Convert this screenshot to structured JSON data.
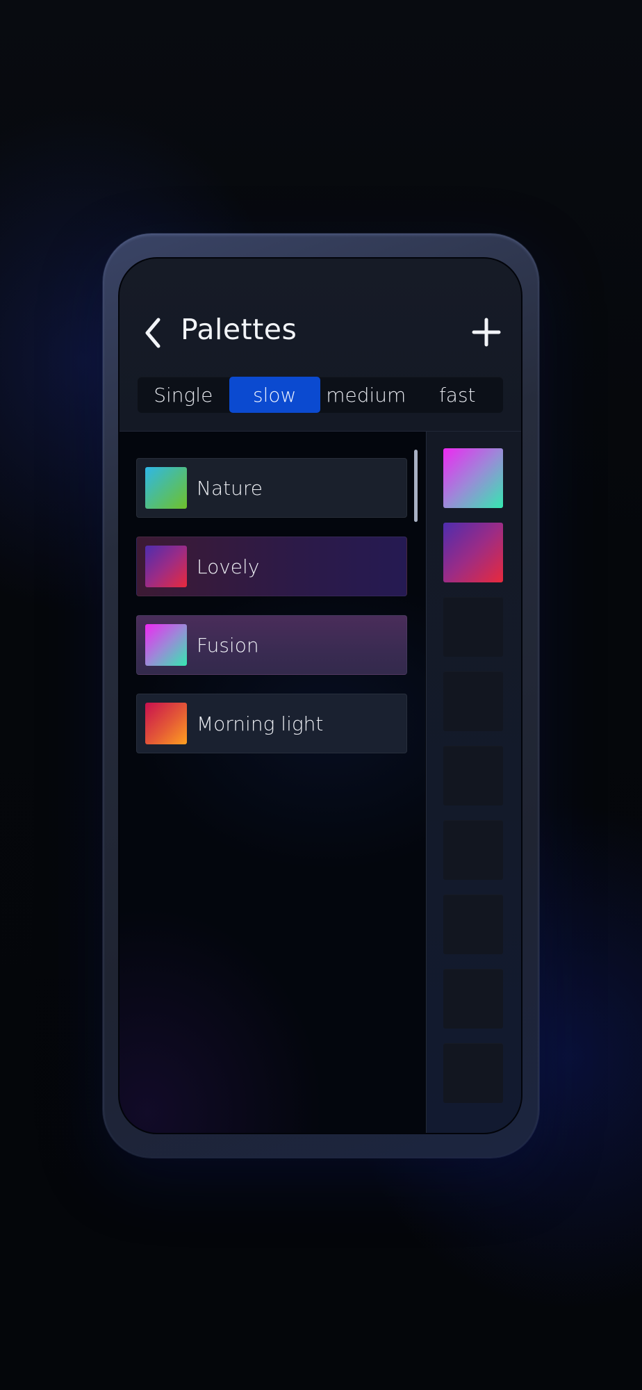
{
  "header": {
    "title": "Palettes",
    "back_icon": "chevron-left-icon",
    "add_icon": "plus-icon"
  },
  "speed_tabs": {
    "selected": "slow",
    "items": [
      "Single",
      "slow",
      "medium",
      "fast"
    ]
  },
  "palettes": [
    {
      "name": "Nature",
      "colors": [
        "#2fb7e8",
        "#6fc12a"
      ],
      "highlight": "none"
    },
    {
      "name": "Lovely",
      "colors": [
        "#4e2dae",
        "#e82a3c"
      ],
      "highlight": "pink"
    },
    {
      "name": "Fusion",
      "colors": [
        "#ee28f2",
        "#34e8b0"
      ],
      "highlight": "purple"
    },
    {
      "name": "Morning light",
      "colors": [
        "#c8104f",
        "#ffa020"
      ],
      "highlight": "none"
    }
  ],
  "sidebar": {
    "filled_slots": [
      {
        "colors": [
          "#ee28f2",
          "#34e8b0"
        ]
      },
      {
        "colors": [
          "#4e2dae",
          "#e82a3c"
        ]
      }
    ],
    "empty_slot_count": 7
  },
  "colors": {
    "accent": "#0b4ad0",
    "background": "#05080f"
  }
}
